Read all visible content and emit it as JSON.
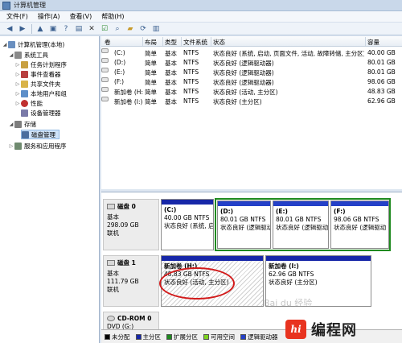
{
  "window": {
    "title": "计算机管理"
  },
  "menu": [
    "文件(F)",
    "操作(A)",
    "查看(V)",
    "帮助(H)"
  ],
  "toolbar": [
    "back-icon",
    "forward-icon",
    "up-folder-icon",
    "console-icon",
    "help-icon",
    "properties-icon",
    "close-icon",
    "check-icon",
    "search-icon",
    "folder-icon",
    "refresh-icon",
    "export-icon"
  ],
  "tree": {
    "root": "计算机管理(本地)",
    "system_tools": "系统工具",
    "items": [
      "任务计划程序",
      "事件查看器",
      "共享文件夹",
      "本地用户和组",
      "性能",
      "设备管理器"
    ],
    "storage": "存储",
    "disk_mgmt": "磁盘管理",
    "services": "服务和应用程序"
  },
  "table": {
    "columns": [
      "卷",
      "布局",
      "类型",
      "文件系统",
      "状态",
      "容量"
    ],
    "rows": [
      [
        "(C:)",
        "简单",
        "基本",
        "NTFS",
        "状态良好 (系统, 启动, 页面文件, 活动, 故障转储, 主分区)",
        "40.00 GB"
      ],
      [
        "(D:)",
        "简单",
        "基本",
        "NTFS",
        "状态良好 (逻辑驱动器)",
        "80.01 GB"
      ],
      [
        "(E:)",
        "简单",
        "基本",
        "NTFS",
        "状态良好 (逻辑驱动器)",
        "80.01 GB"
      ],
      [
        "(F:)",
        "简单",
        "基本",
        "NTFS",
        "状态良好 (逻辑驱动器)",
        "98.06 GB"
      ],
      [
        "新加卷 (H:)",
        "简单",
        "基本",
        "NTFS",
        "状态良好 (活动, 主分区)",
        "48.83 GB"
      ],
      [
        "新加卷 (I:)",
        "简单",
        "基本",
        "NTFS",
        "状态良好 (主分区)",
        "62.96 GB"
      ]
    ]
  },
  "disks": [
    {
      "name": "磁盘 0",
      "type": "基本",
      "size": "298.09 GB",
      "status": "联机"
    },
    {
      "name": "磁盘 1",
      "type": "基本",
      "size": "111.79 GB",
      "status": "联机"
    },
    {
      "name": "CD-ROM 0",
      "type": "DVD (G:)"
    }
  ],
  "volumes": {
    "c": {
      "title": "(C:)",
      "size": "40.00 GB NTFS",
      "status": "状态良好 (系统, 启动, 页"
    },
    "d": {
      "title": "(D:)",
      "size": "80.01 GB NTFS",
      "status": "状态良好 (逻辑驱动"
    },
    "e": {
      "title": "(E:)",
      "size": "80.01 GB NTFS",
      "status": "状态良好 (逻辑驱动"
    },
    "f": {
      "title": "(F:)",
      "size": "98.06 GB NTFS",
      "status": "状态良好 (逻辑驱动"
    },
    "h": {
      "title": "新加卷 (H:)",
      "size": "48.83 GB NTFS",
      "status": "状态良好 (活动, 主分区)"
    },
    "i": {
      "title": "新加卷 (I:)",
      "size": "62.96 GB NTFS",
      "status": "状态良好 (主分区)"
    }
  },
  "legend": [
    {
      "label": "未分配",
      "color": "#000000"
    },
    {
      "label": "主分区",
      "color": "#1727a8"
    },
    {
      "label": "扩展分区",
      "color": "#1f8a1f"
    },
    {
      "label": "可用空间",
      "color": "#7ed321"
    },
    {
      "label": "逻辑驱动器",
      "color": "#2440c8"
    }
  ],
  "watermark": {
    "logo": "hi",
    "text": "编程网",
    "baidu": "Bai du 经验"
  }
}
